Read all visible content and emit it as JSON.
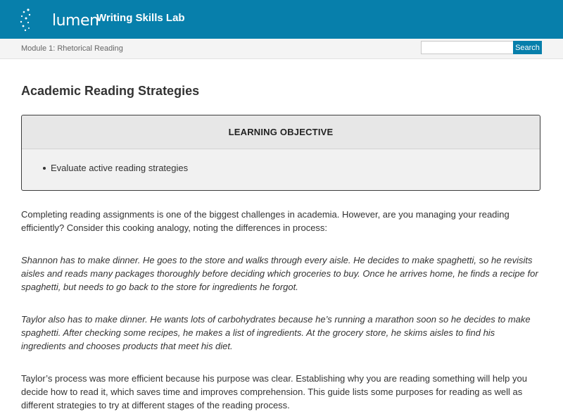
{
  "header": {
    "logo_text": "lumen",
    "course_title": "Writing Skills Lab"
  },
  "nav": {
    "breadcrumb": "Module 1: Rhetorical Reading",
    "search": {
      "value": "",
      "placeholder": "",
      "button_label": "Search"
    }
  },
  "page": {
    "title": "Academic Reading Strategies",
    "learning_objective": {
      "heading": "LEARNING OBJECTIVE",
      "items": [
        "Evaluate active reading strategies"
      ]
    },
    "paragraphs": [
      "Completing reading assignments is one of the biggest challenges in academia. However, are you managing your reading efficiently? Consider this cooking analogy, noting the differences in process:",
      "Shannon has to make dinner. He goes to the store and walks through every aisle. He decides to make spaghetti, so he revisits aisles and reads many packages thoroughly before deciding which groceries to buy. Once he arrives home, he finds a recipe for spaghetti, but needs to go back to the store for ingredients he forgot.",
      "Taylor also has to make dinner. He wants lots of carbohydrates because he’s running a marathon soon so he decides to make spaghetti. After checking some recipes, he makes a list of ingredients. At the grocery store, he skims aisles to find his ingredients and chooses products that meet his diet.",
      "Taylor’s process was more efficient because his purpose was clear. Establishing why you are reading something will help you decide how to read it, which saves time and improves comprehension. This guide lists some purposes for reading as well as different strategies to try at different stages of the reading process."
    ]
  },
  "colors": {
    "brand": "#077fab",
    "nav_background": "#f4f4f4",
    "objective_background": "#f1f1f1",
    "text": "#333333"
  }
}
